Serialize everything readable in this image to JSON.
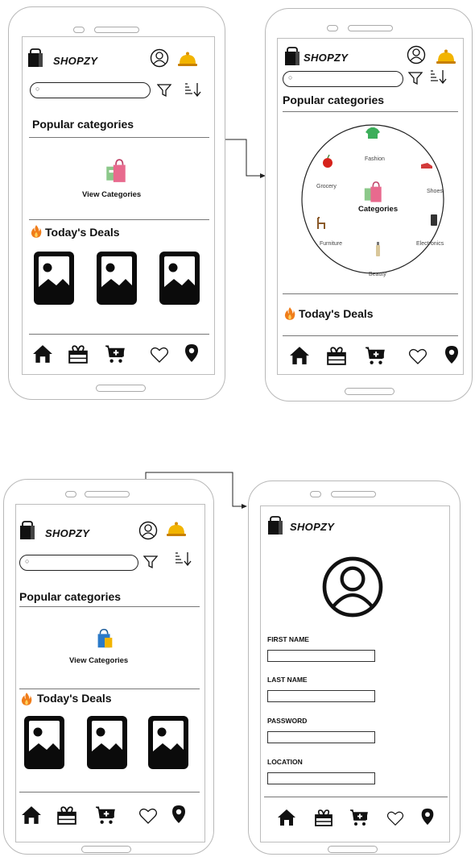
{
  "brand": "SHOPZY",
  "popular_categories_title": "Popular categories",
  "view_categories_label": "View Categories",
  "todays_deals_title": "Today's Deals",
  "category_wheel": {
    "center": "Categories",
    "items": [
      "Fashion",
      "Shoes",
      "Electronics",
      "Beauty",
      "Furniture",
      "Grocery"
    ]
  },
  "profile_form": {
    "fields": [
      "FIRST NAME",
      "LAST NAME",
      "PASSWORD",
      "LOCATION"
    ]
  },
  "nav_icons": [
    "home-icon",
    "gift-icon",
    "cart-icon",
    "heart-icon",
    "location-pin-icon"
  ],
  "colors": {
    "outline": "#b8b8b8",
    "ink": "#111111",
    "bell": "#e5a100",
    "fire": "#f07d1a",
    "bag_pink": "#e86a8e",
    "bag_blue": "#2a79c8"
  }
}
